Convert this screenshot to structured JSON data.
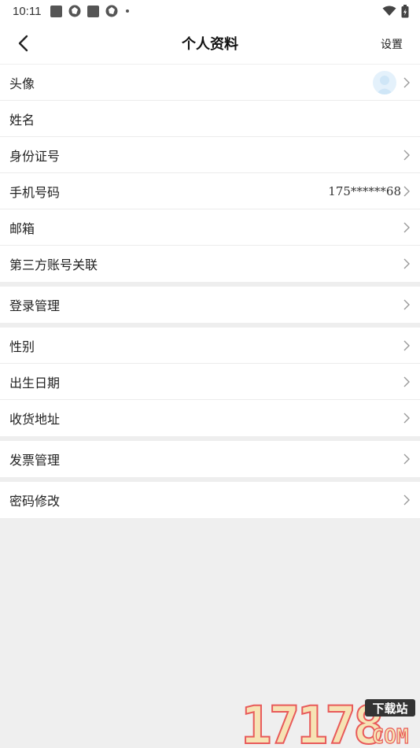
{
  "status_bar": {
    "time": "10:11"
  },
  "nav": {
    "title": "个人资料",
    "settings_label": "设置"
  },
  "groups": [
    {
      "rows": [
        {
          "label": "头像",
          "avatar": true,
          "arrow": true
        },
        {
          "label": "姓名",
          "arrow": false
        },
        {
          "label": "身份证号",
          "arrow": true
        },
        {
          "label": "手机号码",
          "value": "175******68",
          "arrow": true
        },
        {
          "label": "邮箱",
          "arrow": true
        },
        {
          "label": "第三方账号关联",
          "arrow": true
        }
      ]
    },
    {
      "rows": [
        {
          "label": "登录管理",
          "arrow": true
        }
      ]
    },
    {
      "rows": [
        {
          "label": "性别",
          "arrow": true
        },
        {
          "label": "出生日期",
          "arrow": true
        },
        {
          "label": "收货地址",
          "arrow": true
        }
      ]
    },
    {
      "rows": [
        {
          "label": "发票管理",
          "arrow": true
        }
      ]
    },
    {
      "rows": [
        {
          "label": "密码修改",
          "arrow": true
        }
      ]
    }
  ],
  "watermark": {
    "number": "17178",
    "tag": "下载站",
    "domain": "COM"
  },
  "colors": {
    "background": "#efefef",
    "row_bg": "#ffffff",
    "avatar_bg": "#e4f1fb",
    "watermark_red": "#e85a5a"
  }
}
